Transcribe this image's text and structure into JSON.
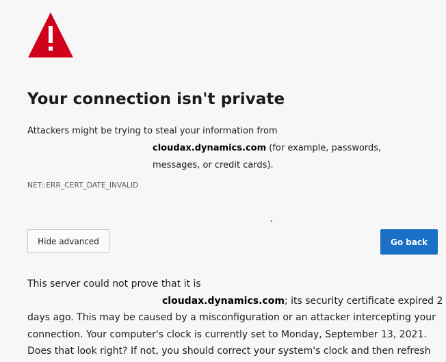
{
  "header": {
    "icon": "warning-triangle-icon",
    "icon_color": "#d0021b",
    "title": "Your connection isn't private"
  },
  "description": {
    "line1": "Attackers might be trying to steal your information from",
    "host": "cloudax.dynamics.com",
    "rest": " (for example, passwords, messages, or credit cards)."
  },
  "error_code": "NET::ERR_CERT_DATE_INVALID",
  "buttons": {
    "advanced_label": "Hide advanced",
    "back_label": "Go back",
    "back_color": "#1a6fc7"
  },
  "details": {
    "line1": "This server could not prove that it is",
    "host": "cloudax.dynamics.com",
    "rest": "; its security certificate expired 2 days ago. This may be caused by a misconfiguration or an attacker intercepting your connection. Your computer's clock is currently set to Monday, September 13, 2021. Does that look right? If not, you should correct your system's clock and then refresh this page."
  }
}
